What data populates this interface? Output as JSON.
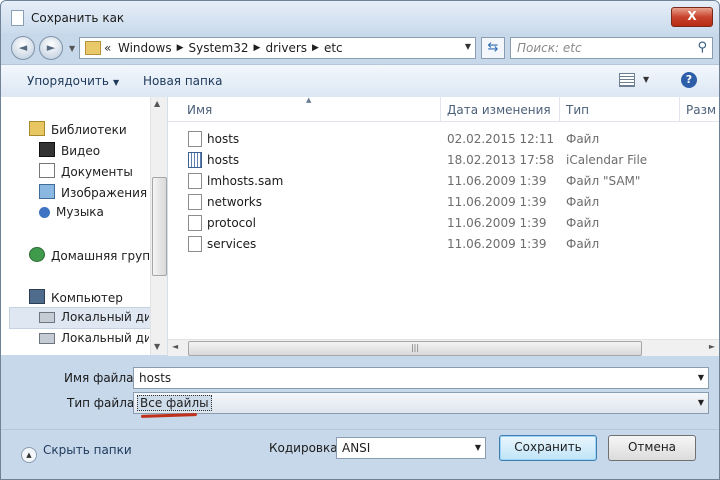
{
  "window": {
    "title": "Сохранить как",
    "close_glyph": "X"
  },
  "nav": {
    "back_glyph": "◄",
    "forward_glyph": "►",
    "address_chevron": "«",
    "path": [
      "Windows",
      "System32",
      "drivers",
      "etc"
    ],
    "search_placeholder": "Поиск: etc"
  },
  "toolbar": {
    "organize": "Упорядочить",
    "new_folder": "Новая папка",
    "help_glyph": "?"
  },
  "sidebar": {
    "libraries": "Библиотеки",
    "video": "Видео",
    "documents": "Документы",
    "images": "Изображения",
    "music": "Музыка",
    "homegroup": "Домашняя группа",
    "computer": "Компьютер",
    "disk1": "Локальный диск",
    "disk2": "Локальный диск"
  },
  "columns": {
    "name": "Имя",
    "date": "Дата изменения",
    "type": "Тип",
    "size": "Разм"
  },
  "files": [
    {
      "name": "hosts",
      "date": "02.02.2015 12:11",
      "type": "Файл",
      "icon": "file-icon"
    },
    {
      "name": "hosts",
      "date": "18.02.2013 17:58",
      "type": "iCalendar File",
      "icon": "calendar-file-icon"
    },
    {
      "name": "lmhosts.sam",
      "date": "11.06.2009 1:39",
      "type": "Файл \"SAM\"",
      "icon": "file-icon"
    },
    {
      "name": "networks",
      "date": "11.06.2009 1:39",
      "type": "Файл",
      "icon": "file-icon"
    },
    {
      "name": "protocol",
      "date": "11.06.2009 1:39",
      "type": "Файл",
      "icon": "file-icon"
    },
    {
      "name": "services",
      "date": "11.06.2009 1:39",
      "type": "Файл",
      "icon": "file-icon"
    }
  ],
  "form": {
    "filename_label": "Имя файла:",
    "filename_value": "hosts",
    "filetype_label": "Тип файла:",
    "filetype_value": "Все файлы",
    "encoding_label": "Кодировка:",
    "encoding_value": "ANSI"
  },
  "footer": {
    "hide_folders": "Скрыть папки",
    "save": "Сохранить",
    "cancel": "Отмена"
  },
  "colors": {
    "accent": "#2d5fa8",
    "highlight_underline": "#c0311c"
  }
}
